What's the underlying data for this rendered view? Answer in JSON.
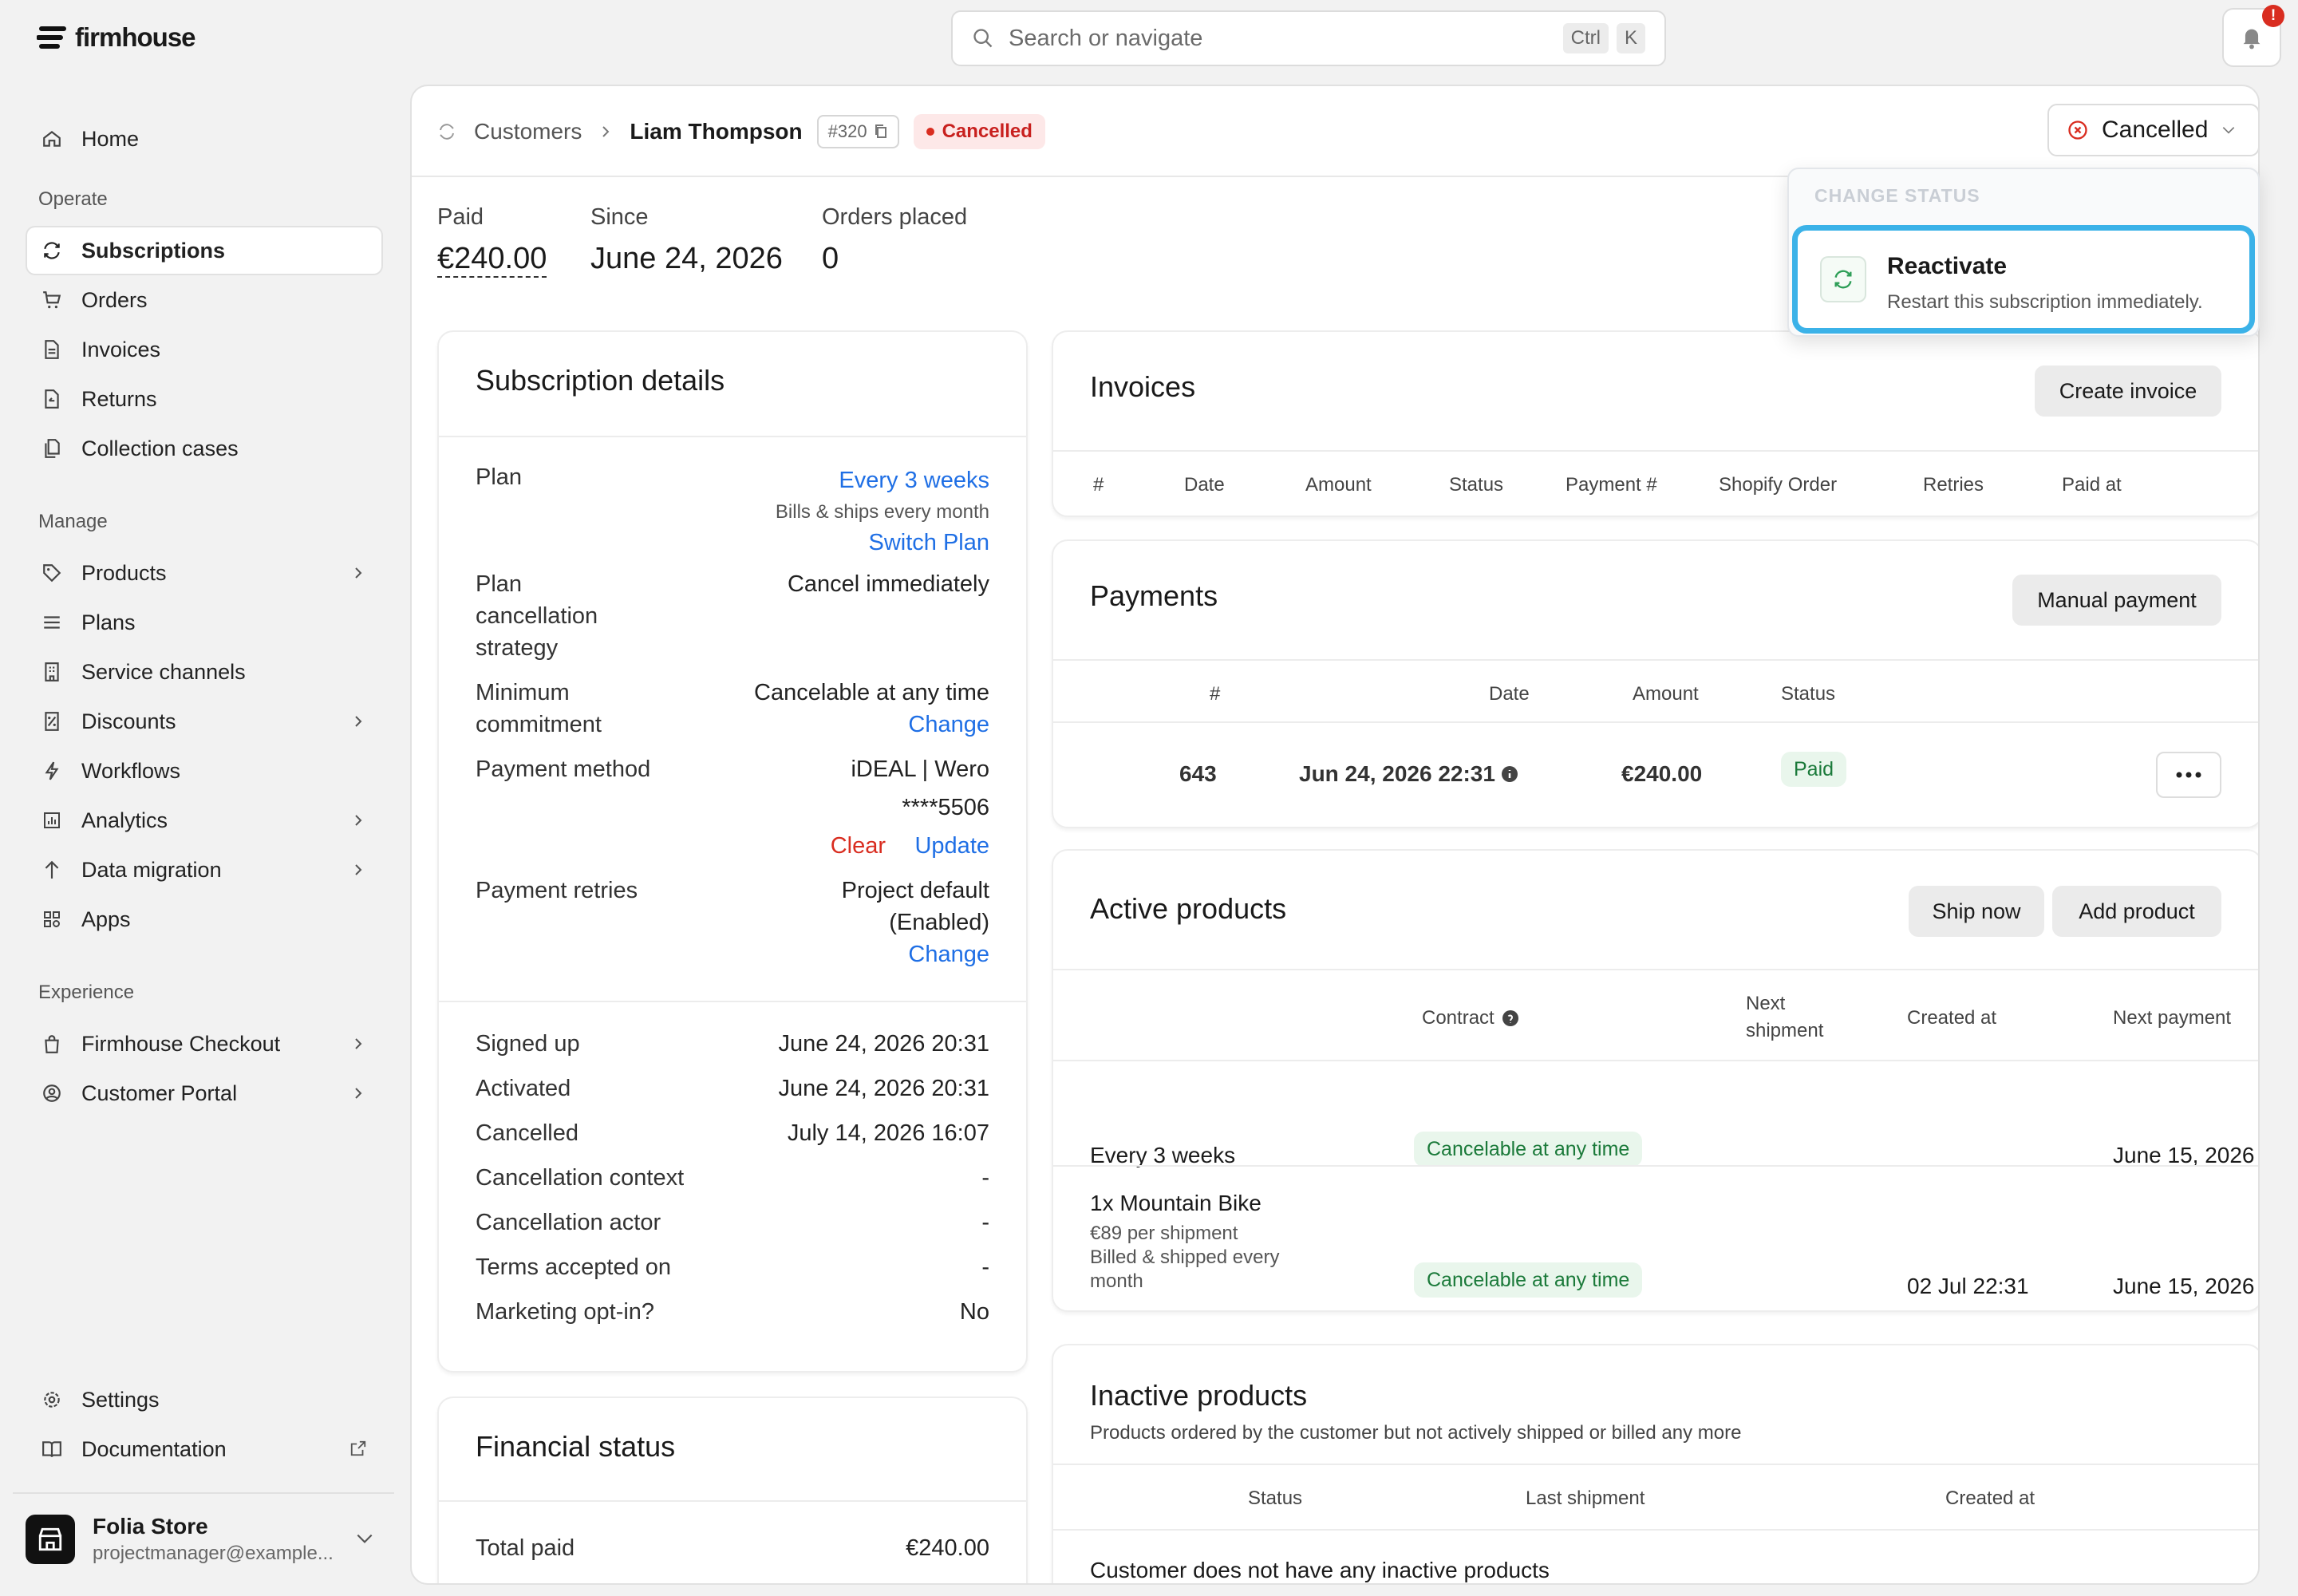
{
  "app": {
    "brand": "firmhouse"
  },
  "search": {
    "placeholder": "Search or navigate",
    "key1": "Ctrl",
    "key2": "K"
  },
  "notifications": {
    "badge": "!"
  },
  "nav": {
    "home": "Home",
    "section_operate": "Operate",
    "subscriptions": "Subscriptions",
    "orders": "Orders",
    "invoices": "Invoices",
    "returns": "Returns",
    "collection_cases": "Collection cases",
    "section_manage": "Manage",
    "products": "Products",
    "plans": "Plans",
    "service_channels": "Service channels",
    "discounts": "Discounts",
    "workflows": "Workflows",
    "analytics": "Analytics",
    "data_migration": "Data migration",
    "apps": "Apps",
    "section_experience": "Experience",
    "firmhouse_checkout": "Firmhouse Checkout",
    "customer_portal": "Customer Portal",
    "settings": "Settings",
    "documentation": "Documentation"
  },
  "account": {
    "name": "Folia Store",
    "email": "projectmanager@example..."
  },
  "header": {
    "crumb_customers": "Customers",
    "customer_name": "Liam Thompson",
    "id": "#320",
    "status_badge": "Cancelled",
    "status_button": "Cancelled"
  },
  "stats": [
    {
      "label": "Paid",
      "value": "€240.00"
    },
    {
      "label": "Since",
      "value": "June 24, 2026"
    },
    {
      "label": "Orders placed",
      "value": "0"
    }
  ],
  "status_menu": {
    "heading": "CHANGE STATUS",
    "option_title": "Reactivate",
    "option_desc": "Restart this subscription immediately."
  },
  "subscription_details": {
    "title": "Subscription details",
    "plan_label": "Plan",
    "plan_value": "Every 3 weeks",
    "plan_sub": "Bills & ships every month",
    "switch_plan": "Switch Plan",
    "cancel_strategy_label1": "Plan",
    "cancel_strategy_label2": "cancellation",
    "cancel_strategy_label3": "strategy",
    "cancel_strategy_value": "Cancel immediately",
    "min_commit_label1": "Minimum",
    "min_commit_label2": "commitment",
    "min_commit_value": "Cancelable at any time",
    "min_commit_change": "Change",
    "payment_method_label": "Payment method",
    "payment_method_value": "iDEAL | Wero",
    "card_mask": "****5506",
    "clear": "Clear",
    "update": "Update",
    "retries_label": "Payment retries",
    "retries_value1": "Project default",
    "retries_value2": "(Enabled)",
    "retries_change": "Change",
    "signed_up_label": "Signed up",
    "signed_up_value": "June 24, 2026 20:31",
    "activated_label": "Activated",
    "activated_value": "June 24, 2026 20:31",
    "cancelled_label": "Cancelled",
    "cancelled_value": "July 14, 2026 16:07",
    "cancel_context_label": "Cancellation context",
    "cancel_context_value": "-",
    "cancel_actor_label": "Cancellation actor",
    "cancel_actor_value": "-",
    "terms_label": "Terms accepted on",
    "terms_value": "-",
    "marketing_label": "Marketing opt-in?",
    "marketing_value": "No"
  },
  "financial": {
    "title": "Financial status",
    "total_paid_label": "Total paid",
    "total_paid_value": "€240.00"
  },
  "invoices": {
    "title": "Invoices",
    "create": "Create invoice",
    "columns": [
      "#",
      "Date",
      "Amount",
      "Status",
      "Payment #",
      "Shopify Order",
      "Retries",
      "Paid at"
    ]
  },
  "payments": {
    "title": "Payments",
    "manual": "Manual payment",
    "columns": [
      "#",
      "Date",
      "Amount",
      "Status"
    ],
    "row": {
      "id": "643",
      "date": "Jun 24, 2026 22:31",
      "amount": "€240.00",
      "status": "Paid"
    }
  },
  "active_products": {
    "title": "Active products",
    "ship_now": "Ship now",
    "add_product": "Add product",
    "columns": {
      "contract": "Contract",
      "next_shipment_1": "Next",
      "next_shipment_2": "shipment",
      "created_at": "Created at",
      "next_payment": "Next payment"
    },
    "rows": [
      {
        "name": "Every 3 weeks",
        "contract": "Cancelable at any time",
        "created": "",
        "next_payment": "June 15, 2026"
      },
      {
        "name": "1x Mountain Bike",
        "sub1": "€89 per shipment",
        "sub2": "Billed & shipped every",
        "sub3": "month",
        "contract": "Cancelable at any time",
        "created": "02 Jul 22:31",
        "next_payment": "June 15, 2026"
      }
    ]
  },
  "inactive_products": {
    "title": "Inactive products",
    "subtitle": "Products ordered by the customer but not actively shipped or billed any more",
    "columns": [
      "Status",
      "Last shipment",
      "Created at"
    ],
    "empty": "Customer does not have any inactive products"
  }
}
